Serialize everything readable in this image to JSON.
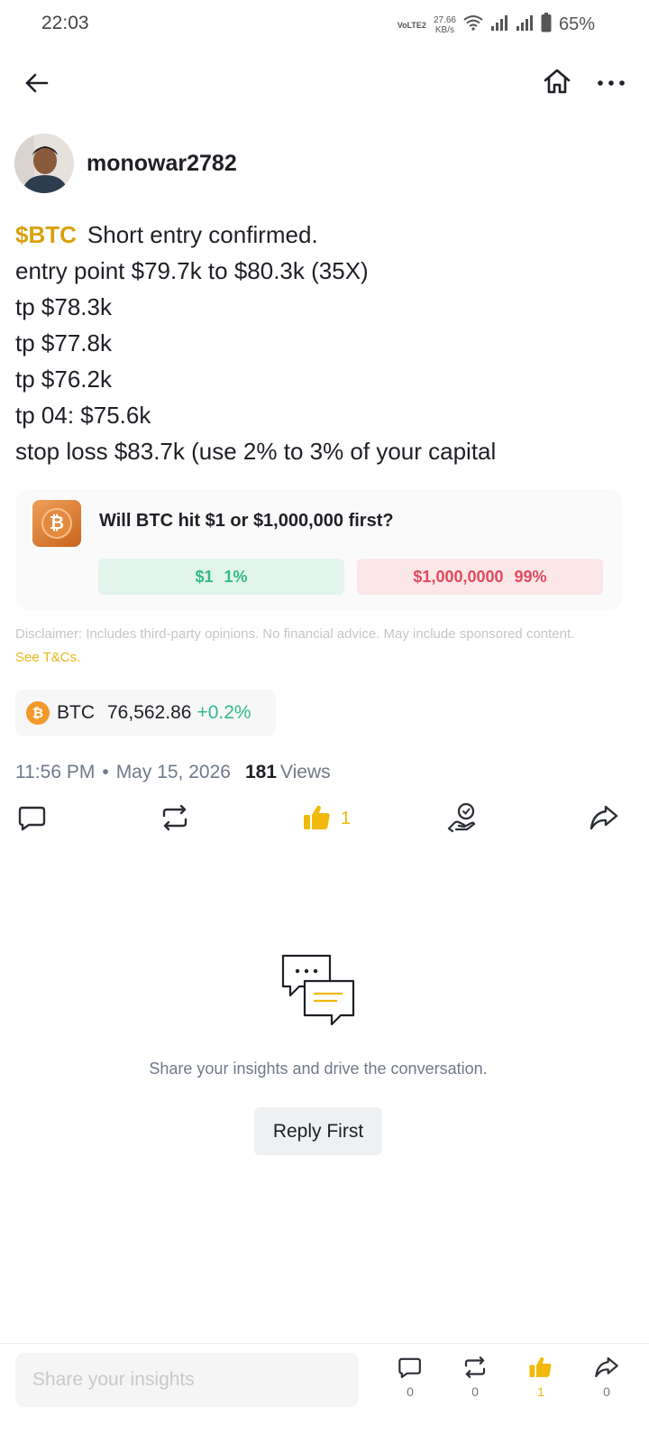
{
  "status_bar": {
    "time": "22:03",
    "volte": "VoLTE2",
    "speed_value": "27.66",
    "speed_unit": "KB/s",
    "battery": "65%"
  },
  "nav": {
    "back_icon": "arrow-left-icon",
    "home_icon": "home-icon",
    "more_icon": "more-dots-icon"
  },
  "author": {
    "username": "monowar2782"
  },
  "post": {
    "ticker": "$BTC",
    "headline": "Short entry confirmed.",
    "lines": [
      "entry point $79.7k to $80.3k (35X)",
      "tp $78.3k",
      "tp $77.8k",
      "tp $76.2k",
      "tp 04: $75.6k",
      "stop loss $83.7k (use 2% to 3% of your capital"
    ]
  },
  "poll": {
    "question": "Will BTC hit $1 or $1,000,000 first?",
    "option_a_label": "$1",
    "option_a_pct": "1%",
    "option_b_label": "$1,000,0000",
    "option_b_pct": "99%",
    "colors": {
      "option_a": "#2ebd85",
      "option_b": "#e24a5f"
    }
  },
  "disclaimer": {
    "text": "Disclaimer: Includes third-party opinions. No financial advice. May include sponsored content.",
    "link": "See T&Cs."
  },
  "coin": {
    "symbol": "BTC",
    "badge": "₿",
    "price": "76,562.86",
    "change": "+0.2%"
  },
  "meta": {
    "time": "11:56 PM",
    "separator": "•",
    "date": "May 15, 2026",
    "views_count": "181",
    "views_label": "Views"
  },
  "actions": {
    "like_count": "1"
  },
  "empty_state": {
    "message": "Share your insights and drive the conversation.",
    "button": "Reply First"
  },
  "bottom_bar": {
    "input_placeholder": "Share your insights",
    "comment_count": "0",
    "repost_count": "0",
    "like_count": "1",
    "share_count": "0"
  },
  "colors": {
    "accent": "#f0b90b",
    "ticker": "#d8a10a",
    "positive": "#2ebd85",
    "negative": "#e24a5f"
  }
}
